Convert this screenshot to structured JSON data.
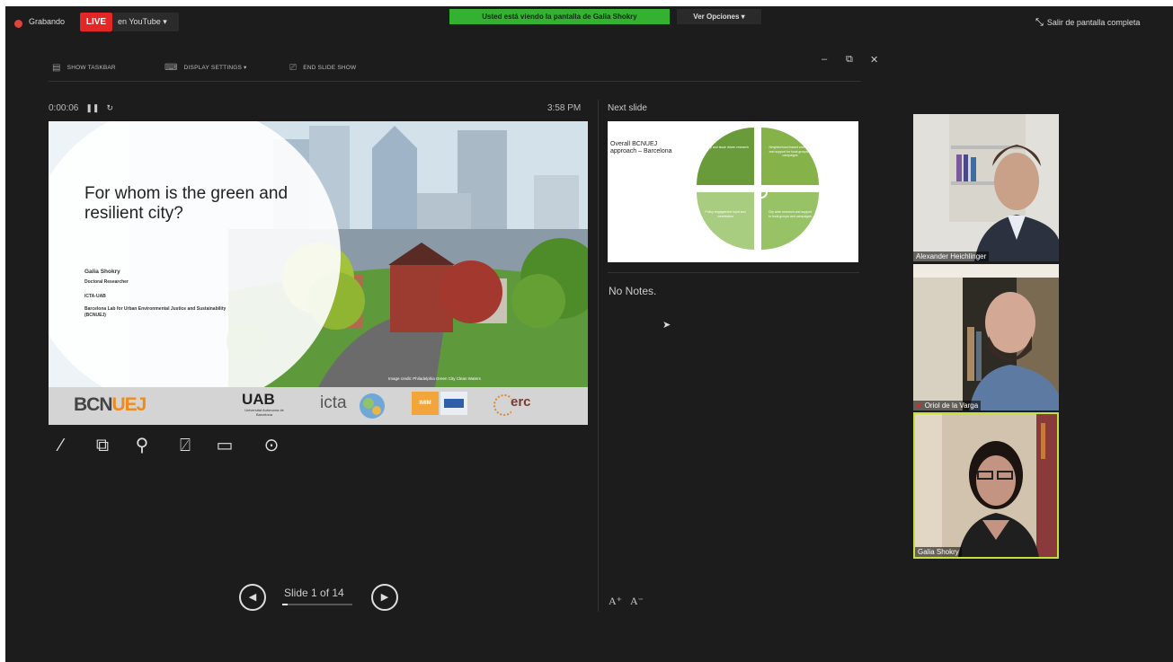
{
  "recording": {
    "label": "Grabando"
  },
  "stream": {
    "live_label": "LIVE",
    "platform_label": "en YouTube"
  },
  "share_banner": "Usted está viendo la pantalla de Galia Shokry",
  "view_options": "Ver Opciones",
  "exit_fullscreen": "Salir de pantalla completa",
  "presenter_toolbar": {
    "show_taskbar": "SHOW TASKBAR",
    "display_settings": "DISPLAY SETTINGS",
    "end_slideshow": "END SLIDE SHOW"
  },
  "timer": "0:00:06",
  "clock": "3:58 PM",
  "next_slide_label": "Next slide",
  "current_slide": {
    "title": "For whom is the green and resilient city?",
    "author": "Galia Shokry",
    "role": "Doctoral Researcher",
    "institution": "ICTA-UAB",
    "lab": "Barcelona Lab for Urban Environmental Justice and Sustainability (BCNUEJ)",
    "image_credit": "Image credit: Philadelphia Green City Clean Waters",
    "logos": {
      "bcnuej_a": "BCN",
      "bcnuej_b": "UEJ",
      "uab": "UAB",
      "uab_sub": "Universitat Autònoma de Barcelona",
      "icta": "icta",
      "imim": "IMIM",
      "erc": "erc"
    }
  },
  "next_slide": {
    "title": "Overall BCNUEJ approach – Barcelona",
    "quadrants": [
      "Theory and issue driven research",
      "Neighborhood based research and support for local groups & campaigns",
      "Policy engagement input and contribution",
      "City wide research and support to local groups and campaigns"
    ]
  },
  "notes": "No Notes.",
  "slide_nav": {
    "counter": "Slide 1 of 14",
    "progress": 0.071
  },
  "participants": [
    {
      "name": "Alexander Heichlinger",
      "muted": false
    },
    {
      "name": "Oriol de la Varga",
      "muted": true
    },
    {
      "name": "Galia Shokry",
      "muted": false,
      "active_speaker": true
    }
  ]
}
